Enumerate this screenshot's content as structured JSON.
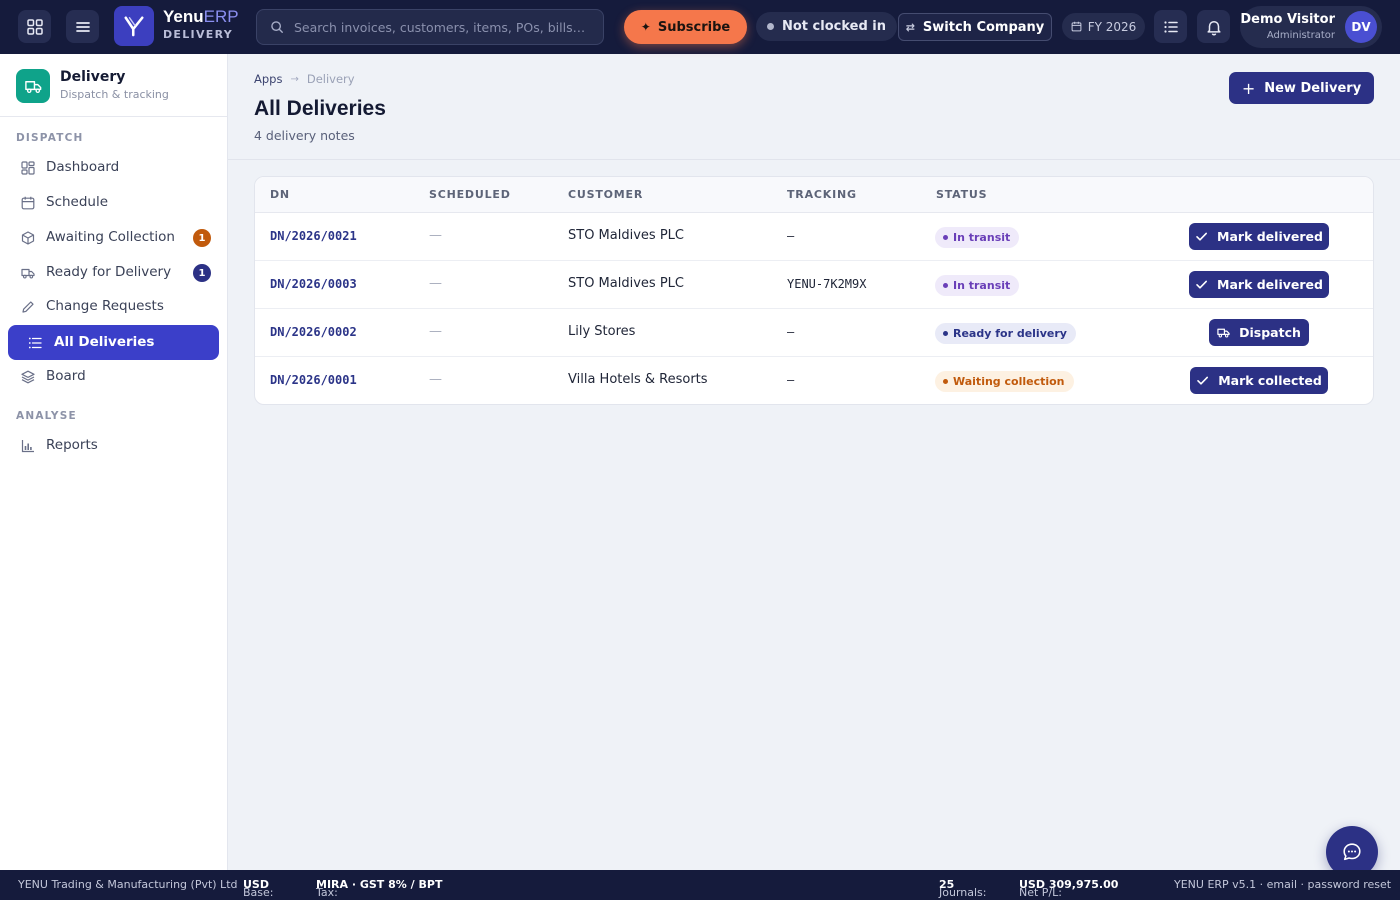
{
  "topbar": {
    "brand_name": "Yenu",
    "brand_suffix": "ERP",
    "brand_module": "DELIVERY",
    "search_placeholder": "Search invoices, customers, items, POs, bills…",
    "subscribe_label": "Subscribe",
    "clock_status": "Not clocked in",
    "switch_company_label": "Switch Company",
    "fiscal_year": "FY 2026",
    "user_name": "Demo Visitor",
    "user_role": "Administrator",
    "user_initials": "DV"
  },
  "sidebar": {
    "app_title": "Delivery",
    "app_subtitle": "Dispatch & tracking",
    "sections": [
      {
        "label": "DISPATCH"
      },
      {
        "label": "ANALYSE"
      }
    ],
    "items": [
      {
        "label": "Dashboard"
      },
      {
        "label": "Schedule"
      },
      {
        "label": "Awaiting Collection",
        "badge": "1",
        "badge_color": "#c15a0c"
      },
      {
        "label": "Ready for Delivery",
        "badge": "1",
        "badge_color": "#2c3185"
      },
      {
        "label": "Change Requests"
      },
      {
        "label": "All Deliveries",
        "active": true
      },
      {
        "label": "Board"
      },
      {
        "label": "Reports"
      }
    ]
  },
  "breadcrumb": {
    "root": "Apps",
    "current": "Delivery"
  },
  "page": {
    "title": "All Deliveries",
    "subtitle": "4 delivery notes",
    "new_button": "New Delivery"
  },
  "table": {
    "columns": [
      "DN",
      "SCHEDULED",
      "CUSTOMER",
      "TRACKING",
      "STATUS"
    ],
    "rows": [
      {
        "dn": "DN/2026/0021",
        "scheduled": "—",
        "customer": "STO Maldives PLC",
        "tracking": "—",
        "status": "In transit",
        "action": "Mark delivered"
      },
      {
        "dn": "DN/2026/0003",
        "scheduled": "—",
        "customer": "STO Maldives PLC",
        "tracking": "YENU-7K2M9X",
        "status": "In transit",
        "action": "Mark delivered"
      },
      {
        "dn": "DN/2026/0002",
        "scheduled": "—",
        "customer": "Lily Stores",
        "tracking": "—",
        "status": "Ready for delivery",
        "action": "Dispatch"
      },
      {
        "dn": "DN/2026/0001",
        "scheduled": "—",
        "customer": "Villa Hotels & Resorts",
        "tracking": "—",
        "status": "Waiting collection",
        "action": "Mark collected"
      }
    ]
  },
  "footer": {
    "company": "YENU Trading & Manufacturing (Pvt) Ltd",
    "base_label": "Base:",
    "base_value": "USD",
    "tax_label": "Tax:",
    "tax_value": "MIRA · GST 8% / BPT",
    "journals_label": "Journals:",
    "journals_value": "25",
    "netpl_label": "Net P/L:",
    "netpl_value": "USD 309,975.00",
    "version": "YENU ERP v5.1 · email · password reset"
  },
  "icons": {
    "apps": "apps-grid-icon",
    "menu": "hamburger-icon",
    "search": "search-icon",
    "bell": "bell-icon",
    "list": "list-icon",
    "chat": "chat-icon",
    "truck": "truck-icon"
  }
}
